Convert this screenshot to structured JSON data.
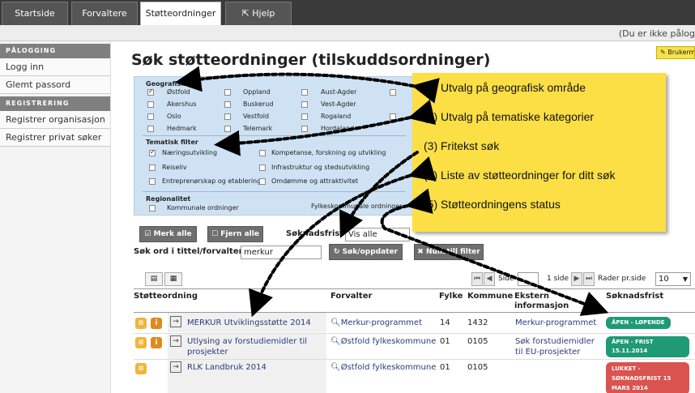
{
  "tabs": {
    "startside": "Startside",
    "forvaltere": "Forvaltere",
    "stotteordninger": "Støtteordninger",
    "hjelp": "Hjelp"
  },
  "login_notice": "(Du er ikke pålog",
  "user_button": "Brukerm",
  "sidebar": {
    "section1": "PÅLOGGING",
    "logg_inn": "Logg inn",
    "glemt_passord": "Glemt passord",
    "section2": "REGISTRERING",
    "reg_org": "Registrer organisasjon",
    "reg_privat": "Registrer privat søker"
  },
  "page_title": "Søk støtteordninger (tilskuddsordninger)",
  "filters": {
    "geo_heading": "Geografisk",
    "geo": [
      "Østfold",
      "Oppland",
      "Aust-Agder",
      "Akershus",
      "Buskerud",
      "Vest-Agder",
      "Oslo",
      "Vestfold",
      "Rogaland",
      "Hedmark",
      "Telemark",
      "Hordaland"
    ],
    "tematisk_heading": "Tematisk filter",
    "tematisk": [
      "Næringsutvikling",
      "Kompetanse, forskning og utvikling",
      "Reiseliv",
      "Infrastruktur og stedsutvikling",
      "Entreprenørskap og etablering",
      "Omdømme og attraktivitet"
    ],
    "regionalitet_heading": "Regionalitet",
    "regional": [
      "Kommunale ordninger",
      "Fylkeskommunale ordninger"
    ]
  },
  "controls": {
    "merk_alle": "Merk alle",
    "fjern_alle": "Fjern alle",
    "soknadsfrist_label": "Søknadsfrist",
    "soknadsfrist_value": "Vis alle",
    "search_label": "Søk ord i tittel/forvalter",
    "search_value": "merkur",
    "sok_button": "Søk/oppdater",
    "nullstill_button": "Nullstill filter"
  },
  "pager": {
    "side_label": "Side",
    "page_info": "1 side",
    "rader_label": "Rader pr.side",
    "rader_value": "10"
  },
  "table": {
    "headers": [
      "Støtteordning",
      "Forvalter",
      "Fylke",
      "Kommune",
      "Ekstern informasjon",
      "Søknadsfrist"
    ],
    "rows": [
      {
        "name": "MERKUR Utviklingsstøtte 2014",
        "forvalter": "Merkur-programmet",
        "fylke": "14",
        "kommune": "1432",
        "ekstern": "Merkur-programmet",
        "status": "ÅPEN - LØPENDE"
      },
      {
        "name": "Utlysing av forstudiemidler til prosjekter",
        "forvalter": "Østfold fylkeskommune",
        "fylke": "01",
        "kommune": "0105",
        "ekstern": "Søk forstudiemidler til EU-prosjekter",
        "status": "ÅPEN - FRIST 15.11.2014"
      },
      {
        "name": "RLK Landbruk 2014",
        "forvalter": "Østfold fylkeskommune",
        "fylke": "01",
        "kommune": "0105",
        "ekstern": "",
        "status": "LUKKET - SØKNADSFRIST 15 MARS 2014"
      }
    ]
  },
  "callouts": [
    "(1) Utvalg på geografisk område",
    "(2) Utvalg på tematiske kategorier",
    "(3) Fritekst søk",
    "(4) Liste av støtteordninger for ditt søk",
    "(5) Støtteordningens status"
  ],
  "colors": {
    "callout_bg": "#fbdf45",
    "filter_bg": "#cfe2f3",
    "badge_open": "#1e9a74",
    "badge_closed": "#d9534f",
    "link": "#2a3b78"
  }
}
